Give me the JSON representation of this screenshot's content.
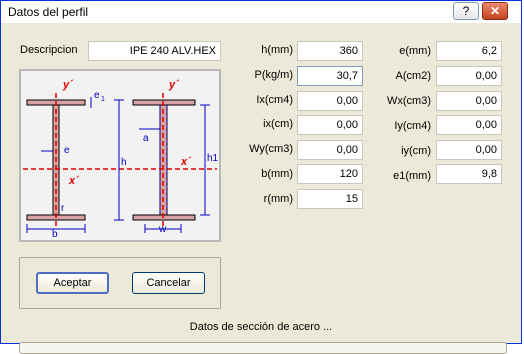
{
  "window": {
    "title": "Datos del perfil"
  },
  "titlebar": {
    "help_glyph": "?",
    "close_glyph": "✕"
  },
  "description": {
    "label": "Descripcion",
    "value": "IPE 240 ALV.HEX"
  },
  "column1": [
    {
      "label": "h(mm)",
      "value": "360"
    },
    {
      "label": "P(kg/m)",
      "value": "30,7"
    },
    {
      "label": "Ix(cm4)",
      "value": "0,00"
    },
    {
      "label": "ix(cm)",
      "value": "0,00"
    },
    {
      "label": "Wy(cm3)",
      "value": "0,00"
    },
    {
      "label": "b(mm)",
      "value": "120"
    },
    {
      "label": "r(mm)",
      "value": "15"
    }
  ],
  "column2": [
    {
      "label": "e(mm)",
      "value": "6,2"
    },
    {
      "label": "A(cm2)",
      "value": "0,00"
    },
    {
      "label": "Wx(cm3)",
      "value": "0,00"
    },
    {
      "label": "Iy(cm4)",
      "value": "0,00"
    },
    {
      "label": "iy(cm)",
      "value": "0,00"
    },
    {
      "label": "e1(mm)",
      "value": "9,8"
    }
  ],
  "drawing": {
    "y_axis_left": "y´",
    "x_axis_left": "x´",
    "y_axis_right": "y´",
    "x_axis_right": "x´",
    "dim_e1": "e",
    "dim_e1_sub": "1",
    "dim_e": "e",
    "dim_r": "r",
    "dim_h": "h",
    "dim_b": "b",
    "dim_a": "a",
    "dim_h1": "h1",
    "dim_w": "w"
  },
  "buttons": {
    "accept": "Aceptar",
    "cancel": "Cancelar"
  },
  "status_text": "Datos de sección de acero ...",
  "progress": {
    "fraction": 0
  },
  "colors": {
    "axis": "#e00000",
    "dimension": "#0000c0",
    "section_fill": "#d9a3a3"
  }
}
